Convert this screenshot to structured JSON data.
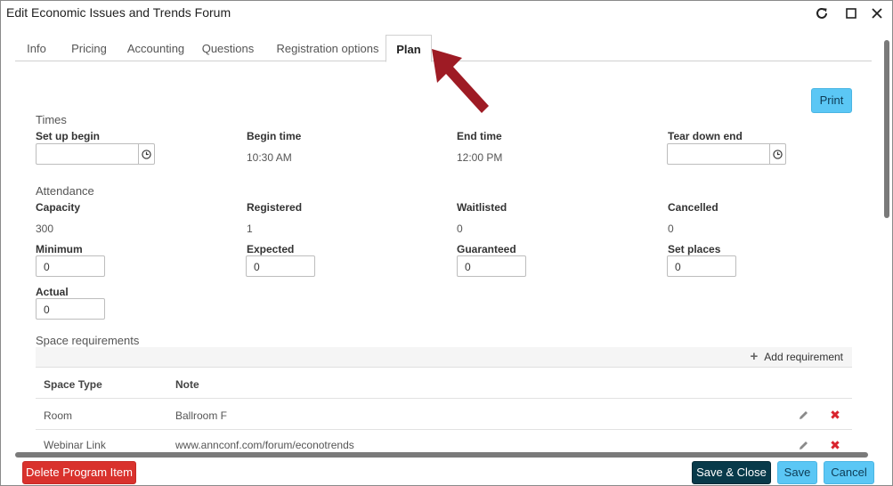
{
  "window": {
    "title": "Edit Economic Issues and Trends Forum",
    "controls": [
      "refresh-icon",
      "maximize-icon",
      "close-icon"
    ]
  },
  "tabs": [
    {
      "label": "Info"
    },
    {
      "label": "Pricing"
    },
    {
      "label": "Accounting"
    },
    {
      "label": "Questions"
    },
    {
      "label": "Registration options"
    },
    {
      "label": "Plan",
      "active": true
    }
  ],
  "print_label": "Print",
  "times": {
    "section": "Times",
    "setup_begin_label": "Set up begin",
    "setup_begin_value": "",
    "begin_time_label": "Begin time",
    "begin_time_value": "10:30 AM",
    "end_time_label": "End time",
    "end_time_value": "12:00 PM",
    "teardown_end_label": "Tear down end",
    "teardown_end_value": ""
  },
  "attendance": {
    "section": "Attendance",
    "capacity_label": "Capacity",
    "capacity_value": "300",
    "registered_label": "Registered",
    "registered_value": "1",
    "waitlisted_label": "Waitlisted",
    "waitlisted_value": "0",
    "cancelled_label": "Cancelled",
    "cancelled_value": "0",
    "minimum_label": "Minimum",
    "minimum_value": "0",
    "expected_label": "Expected",
    "expected_value": "0",
    "guaranteed_label": "Guaranteed",
    "guaranteed_value": "0",
    "set_places_label": "Set places",
    "set_places_value": "0",
    "actual_label": "Actual",
    "actual_value": "0"
  },
  "space": {
    "section": "Space requirements",
    "add_label": "Add requirement",
    "columns": [
      "Space Type",
      "Note"
    ],
    "rows": [
      {
        "type": "Room",
        "note": "Ballroom F"
      },
      {
        "type": "Webinar Link",
        "note": "www.annconf.com/forum/econotrends"
      }
    ]
  },
  "footer": {
    "delete_label": "Delete Program Item",
    "save_close_label": "Save & Close",
    "save_label": "Save",
    "cancel_label": "Cancel"
  },
  "colors": {
    "accent": "#5bc7f5",
    "danger": "#d9322d",
    "dark_button": "#083a4a",
    "annotation_arrow": "#9e1b24"
  }
}
